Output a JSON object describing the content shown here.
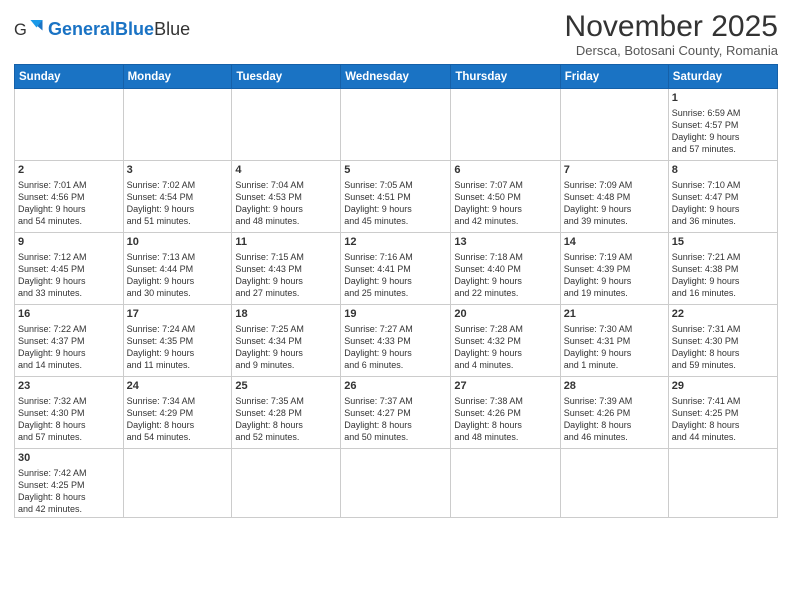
{
  "logo": {
    "text_general": "General",
    "text_blue": "Blue"
  },
  "header": {
    "month_title": "November 2025",
    "subtitle": "Dersca, Botosani County, Romania"
  },
  "days_of_week": [
    "Sunday",
    "Monday",
    "Tuesday",
    "Wednesday",
    "Thursday",
    "Friday",
    "Saturday"
  ],
  "weeks": [
    [
      {
        "day": "",
        "info": ""
      },
      {
        "day": "",
        "info": ""
      },
      {
        "day": "",
        "info": ""
      },
      {
        "day": "",
        "info": ""
      },
      {
        "day": "",
        "info": ""
      },
      {
        "day": "",
        "info": ""
      },
      {
        "day": "1",
        "info": "Sunrise: 6:59 AM\nSunset: 4:57 PM\nDaylight: 9 hours\nand 57 minutes."
      }
    ],
    [
      {
        "day": "2",
        "info": "Sunrise: 7:01 AM\nSunset: 4:56 PM\nDaylight: 9 hours\nand 54 minutes."
      },
      {
        "day": "3",
        "info": "Sunrise: 7:02 AM\nSunset: 4:54 PM\nDaylight: 9 hours\nand 51 minutes."
      },
      {
        "day": "4",
        "info": "Sunrise: 7:04 AM\nSunset: 4:53 PM\nDaylight: 9 hours\nand 48 minutes."
      },
      {
        "day": "5",
        "info": "Sunrise: 7:05 AM\nSunset: 4:51 PM\nDaylight: 9 hours\nand 45 minutes."
      },
      {
        "day": "6",
        "info": "Sunrise: 7:07 AM\nSunset: 4:50 PM\nDaylight: 9 hours\nand 42 minutes."
      },
      {
        "day": "7",
        "info": "Sunrise: 7:09 AM\nSunset: 4:48 PM\nDaylight: 9 hours\nand 39 minutes."
      },
      {
        "day": "8",
        "info": "Sunrise: 7:10 AM\nSunset: 4:47 PM\nDaylight: 9 hours\nand 36 minutes."
      }
    ],
    [
      {
        "day": "9",
        "info": "Sunrise: 7:12 AM\nSunset: 4:45 PM\nDaylight: 9 hours\nand 33 minutes."
      },
      {
        "day": "10",
        "info": "Sunrise: 7:13 AM\nSunset: 4:44 PM\nDaylight: 9 hours\nand 30 minutes."
      },
      {
        "day": "11",
        "info": "Sunrise: 7:15 AM\nSunset: 4:43 PM\nDaylight: 9 hours\nand 27 minutes."
      },
      {
        "day": "12",
        "info": "Sunrise: 7:16 AM\nSunset: 4:41 PM\nDaylight: 9 hours\nand 25 minutes."
      },
      {
        "day": "13",
        "info": "Sunrise: 7:18 AM\nSunset: 4:40 PM\nDaylight: 9 hours\nand 22 minutes."
      },
      {
        "day": "14",
        "info": "Sunrise: 7:19 AM\nSunset: 4:39 PM\nDaylight: 9 hours\nand 19 minutes."
      },
      {
        "day": "15",
        "info": "Sunrise: 7:21 AM\nSunset: 4:38 PM\nDaylight: 9 hours\nand 16 minutes."
      }
    ],
    [
      {
        "day": "16",
        "info": "Sunrise: 7:22 AM\nSunset: 4:37 PM\nDaylight: 9 hours\nand 14 minutes."
      },
      {
        "day": "17",
        "info": "Sunrise: 7:24 AM\nSunset: 4:35 PM\nDaylight: 9 hours\nand 11 minutes."
      },
      {
        "day": "18",
        "info": "Sunrise: 7:25 AM\nSunset: 4:34 PM\nDaylight: 9 hours\nand 9 minutes."
      },
      {
        "day": "19",
        "info": "Sunrise: 7:27 AM\nSunset: 4:33 PM\nDaylight: 9 hours\nand 6 minutes."
      },
      {
        "day": "20",
        "info": "Sunrise: 7:28 AM\nSunset: 4:32 PM\nDaylight: 9 hours\nand 4 minutes."
      },
      {
        "day": "21",
        "info": "Sunrise: 7:30 AM\nSunset: 4:31 PM\nDaylight: 9 hours\nand 1 minute."
      },
      {
        "day": "22",
        "info": "Sunrise: 7:31 AM\nSunset: 4:30 PM\nDaylight: 8 hours\nand 59 minutes."
      }
    ],
    [
      {
        "day": "23",
        "info": "Sunrise: 7:32 AM\nSunset: 4:30 PM\nDaylight: 8 hours\nand 57 minutes."
      },
      {
        "day": "24",
        "info": "Sunrise: 7:34 AM\nSunset: 4:29 PM\nDaylight: 8 hours\nand 54 minutes."
      },
      {
        "day": "25",
        "info": "Sunrise: 7:35 AM\nSunset: 4:28 PM\nDaylight: 8 hours\nand 52 minutes."
      },
      {
        "day": "26",
        "info": "Sunrise: 7:37 AM\nSunset: 4:27 PM\nDaylight: 8 hours\nand 50 minutes."
      },
      {
        "day": "27",
        "info": "Sunrise: 7:38 AM\nSunset: 4:26 PM\nDaylight: 8 hours\nand 48 minutes."
      },
      {
        "day": "28",
        "info": "Sunrise: 7:39 AM\nSunset: 4:26 PM\nDaylight: 8 hours\nand 46 minutes."
      },
      {
        "day": "29",
        "info": "Sunrise: 7:41 AM\nSunset: 4:25 PM\nDaylight: 8 hours\nand 44 minutes."
      }
    ],
    [
      {
        "day": "30",
        "info": "Sunrise: 7:42 AM\nSunset: 4:25 PM\nDaylight: 8 hours\nand 42 minutes."
      },
      {
        "day": "",
        "info": ""
      },
      {
        "day": "",
        "info": ""
      },
      {
        "day": "",
        "info": ""
      },
      {
        "day": "",
        "info": ""
      },
      {
        "day": "",
        "info": ""
      },
      {
        "day": "",
        "info": ""
      }
    ]
  ]
}
